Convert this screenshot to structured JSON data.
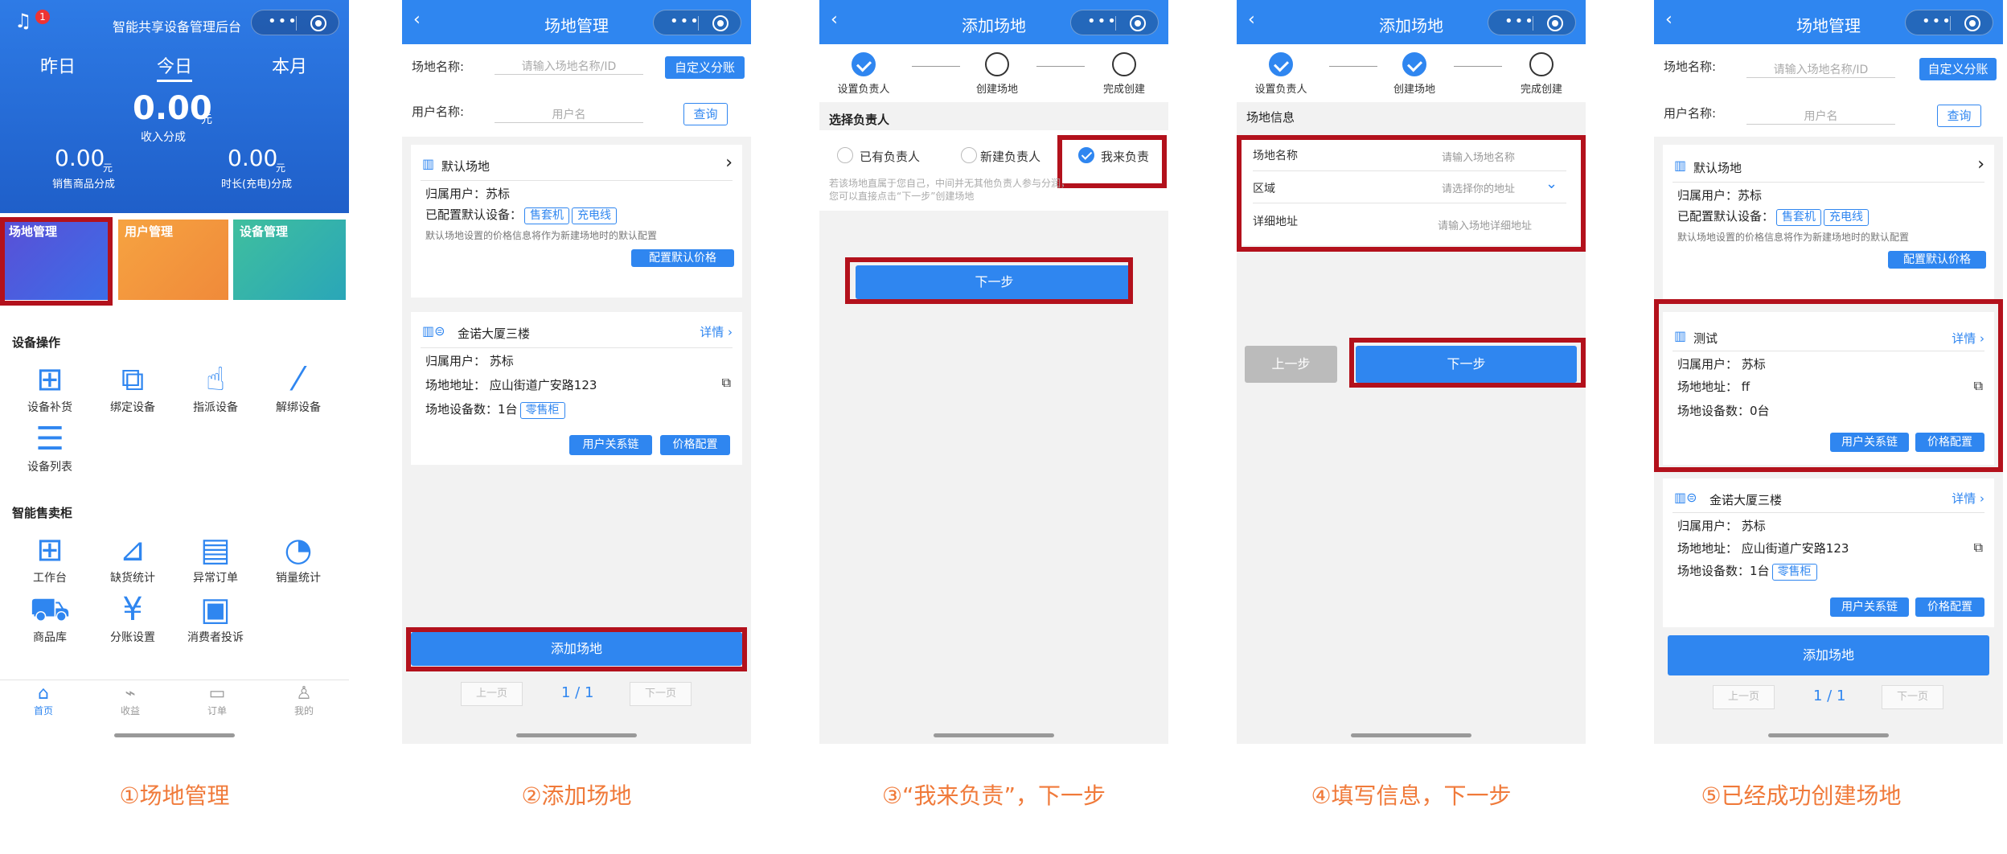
{
  "colors": {
    "primary": "#2f86f0",
    "highlight": "#b3111c",
    "caption": "#f07a3a"
  },
  "captions": [
    "①场地管理",
    "②添加场地",
    "③“我来负责”，下一步",
    "④填写信息，下一步",
    "⑤已经成功创建场地"
  ],
  "p1": {
    "title": "智能共享设备管理后台",
    "badge": "1",
    "tabs": [
      "昨日",
      "今日",
      "本月"
    ],
    "big_value": "0.00",
    "big_unit": "元",
    "big_label": "收入分成",
    "left_value": "0.00",
    "left_unit": "元",
    "left_label": "销售商品分成",
    "right_value": "0.00",
    "right_unit": "元",
    "right_label": "时长(充电)分成",
    "banners": [
      "场地管理",
      "用户管理",
      "设备管理"
    ],
    "section1": "设备操作",
    "ops": [
      "设备补货",
      "绑定设备",
      "指派设备",
      "解绑设备",
      "设备列表"
    ],
    "section2": "智能售卖柜",
    "cabinet": [
      "工作台",
      "缺货统计",
      "异常订单",
      "销量统计",
      "商品库",
      "分账设置",
      "消费者投诉"
    ],
    "nav": [
      "首页",
      "收益",
      "订单",
      "我的"
    ]
  },
  "venue_list": {
    "title": "场地管理",
    "name_label": "场地名称:",
    "name_placeholder": "请输入场地名称/ID",
    "custom_btn": "自定义分账",
    "user_label": "用户名称:",
    "user_placeholder": "用户名",
    "query_btn": "查询",
    "default": {
      "title": "默认场地",
      "owner": "归属用户：苏标",
      "configured": "已配置默认设备：",
      "tags": [
        "售套机",
        "充电线"
      ],
      "note": "默认场地设置的价格信息将作为新建场地时的默认配置",
      "btn": "配置默认价格"
    },
    "detail": "详情",
    "owner_label": "归属用户：",
    "owner": "苏标",
    "addr_label": "场地地址：",
    "count_label": "场地设备数：",
    "btn_rel": "用户关系链",
    "btn_price": "价格配置",
    "venue1": {
      "name": "金诺大厦三楼",
      "addr": "应山街道广安路123",
      "count": "1台",
      "tag": "零售柜"
    },
    "venue_test": {
      "name": "测试",
      "addr": "ff",
      "count": "0台"
    },
    "add_btn": "添加场地",
    "prev": "上一页",
    "next": "下一页",
    "page": "1 / 1"
  },
  "p3": {
    "title": "添加场地",
    "steps": [
      "设置负责人",
      "创建场地",
      "完成创建"
    ],
    "section": "选择负责人",
    "options": [
      "已有负责人",
      "新建负责人",
      "我来负责"
    ],
    "note": "若该场地直属于您自己，中间并无其他负责人参与分润，您可以直接点击“下一步”创建场地",
    "next": "下一步"
  },
  "p4": {
    "title": "添加场地",
    "section": "场地信息",
    "fields": [
      {
        "label": "场地名称",
        "placeholder": "请输入场地名称"
      },
      {
        "label": "区域",
        "placeholder": "请选择你的地址"
      },
      {
        "label": "详细地址",
        "placeholder": "请输入场地详细地址"
      }
    ],
    "prev": "上一步",
    "next": "下一步"
  }
}
